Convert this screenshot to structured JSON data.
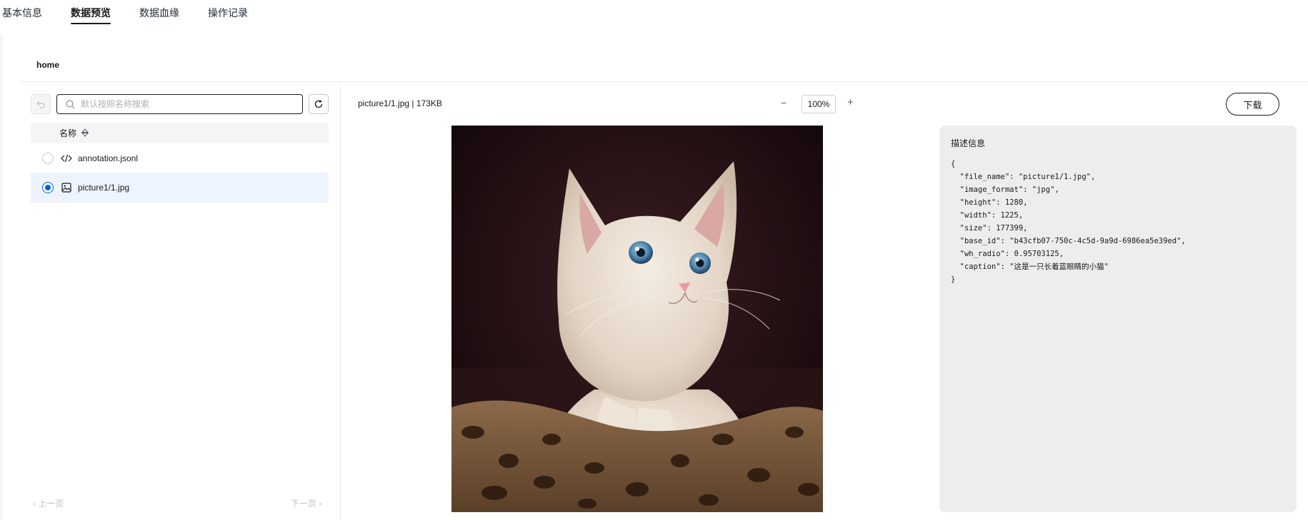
{
  "tabs": [
    {
      "label": "基本信息"
    },
    {
      "label": "数据预览"
    },
    {
      "label": "数据血缘"
    },
    {
      "label": "操作记录"
    }
  ],
  "breadcrumb": "home",
  "search": {
    "placeholder": "默认按照名称搜索"
  },
  "table": {
    "name_header": "名称"
  },
  "files": [
    {
      "name": "annotation.jsonl",
      "icon": "code-file-icon",
      "selected": false
    },
    {
      "name": "picture1/1.jpg",
      "icon": "image-file-icon",
      "selected": true
    }
  ],
  "pager": {
    "prev": "上一页",
    "next": "下一页"
  },
  "preview": {
    "file_info": "picture1/1.jpg | 173KB",
    "zoom": "100%",
    "download": "下载"
  },
  "description": {
    "title": "描述信息",
    "json": "{\n  \"file_name\": \"picture1/1.jpg\",\n  \"image_format\": \"jpg\",\n  \"height\": 1280,\n  \"width\": 1225,\n  \"size\": 177399,\n  \"base_id\": \"b43cfb07-750c-4c5d-9a9d-6986ea5e39ed\",\n  \"wh_radio\": 0.95703125,\n  \"caption\": \"这是一只长着蓝眼睛的小猫\"\n}"
  },
  "colors": {
    "accent": "#0062d9",
    "selected_row": "#eef4ff"
  }
}
